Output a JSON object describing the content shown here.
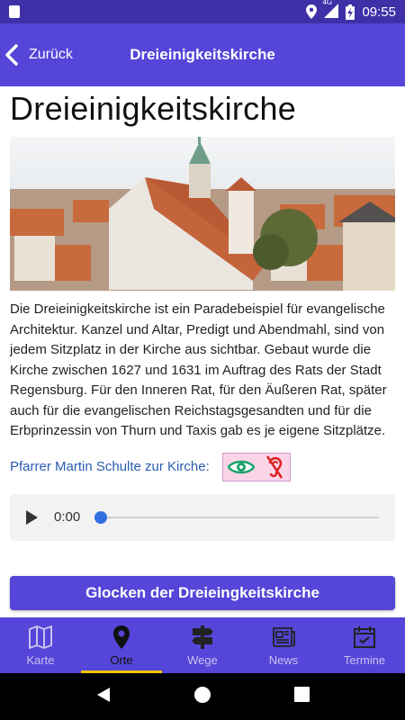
{
  "status_bar": {
    "network": "4G",
    "time": "09:55"
  },
  "app_bar": {
    "back_label": "Zurück",
    "title": "Dreieinigkeitskirche"
  },
  "page": {
    "heading": "Dreieinigkeitskirche",
    "description": "Die Dreieinigkeitskirche ist ein Paradebeispiel für evangelische Architektur. Kanzel und Altar, Predigt und Abendmahl, sind von jedem Sitzplatz in der Kirche aus sichtbar. Gebaut wurde die Kirche zwischen 1627 und 1631 im Auftrag des Rats der Stadt Regensburg. Für den Inneren Rat, für den Äußeren Rat, später auch für die evangelischen Reichstagsgesandten und für die Erbprinzessin von Thurn und Taxis gab es je eigene Sitzplätze.",
    "speaker_label": "Pfarrer Martin Schulte zur Kirche:",
    "accessibility_icons": [
      "eye-icon",
      "hearing-impaired-icon"
    ]
  },
  "audio_player": {
    "time": "0:00",
    "progress": 0
  },
  "bells_button": "Glocken der Dreieingkeitskirche",
  "tabs": [
    {
      "label": "Karte",
      "icon": "map-icon",
      "active": false
    },
    {
      "label": "Orte",
      "icon": "location-pin-icon",
      "active": true
    },
    {
      "label": "Wege",
      "icon": "signpost-icon",
      "active": false
    },
    {
      "label": "News",
      "icon": "newspaper-icon",
      "active": false
    },
    {
      "label": "Termine",
      "icon": "calendar-check-icon",
      "active": false
    }
  ],
  "colors": {
    "primary": "#5545d8",
    "status_bar": "#3f30a8",
    "active_indicator": "#f2c500",
    "link": "#2a5db0"
  }
}
